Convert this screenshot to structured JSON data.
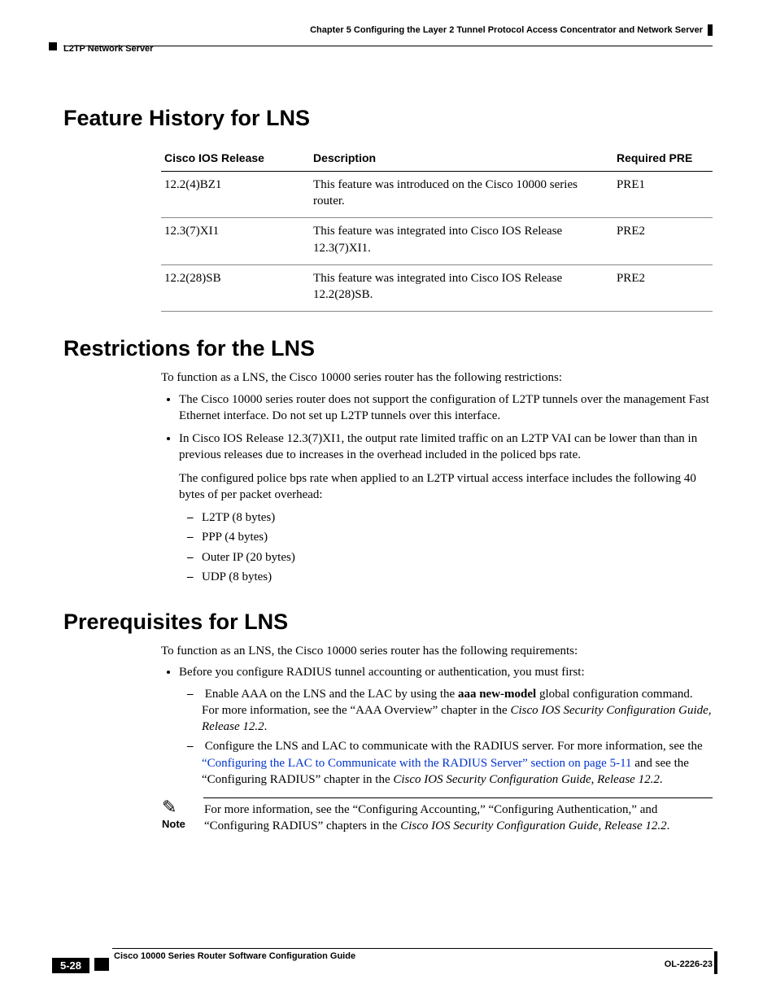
{
  "header": {
    "chapter": "Chapter 5      Configuring the Layer 2 Tunnel Protocol Access Concentrator and Network Server",
    "section": "L2TP Network Server"
  },
  "s1": {
    "heading": "Feature History for LNS",
    "th1": "Cisco IOS Release",
    "th2": "Description",
    "th3": "Required PRE",
    "rows": [
      {
        "r": "12.2(4)BZ1",
        "d": "This feature was introduced on the Cisco 10000 series router.",
        "p": "PRE1"
      },
      {
        "r": "12.3(7)XI1",
        "d": "This feature was integrated into Cisco IOS Release 12.3(7)XI1.",
        "p": "PRE2"
      },
      {
        "r": "12.2(28)SB",
        "d": "This feature was integrated into Cisco IOS Release 12.2(28)SB.",
        "p": "PRE2"
      }
    ]
  },
  "s2": {
    "heading": "Restrictions for the LNS",
    "intro": "To function as a LNS, the Cisco 10000 series router has the following restrictions:",
    "b1": "The Cisco 10000 series router does not support the configuration of L2TP tunnels over the management Fast Ethernet interface. Do not set up L2TP tunnels over this interface.",
    "b2": "In Cisco IOS Release 12.3(7)XI1, the output rate limited traffic on an L2TP VAI can be lower than than in previous releases due to increases in the overhead included in the policed bps rate.",
    "b2p": "The configured police bps rate when applied to an L2TP virtual access interface includes the following 40 bytes of per packet overhead:",
    "d1": "L2TP (8 bytes)",
    "d2": "PPP (4 bytes)",
    "d3": "Outer IP (20 bytes)",
    "d4": "UDP (8 bytes)"
  },
  "s3": {
    "heading": "Prerequisites for LNS",
    "intro": "To function as an LNS, the Cisco 10000 series router has the following requirements:",
    "b1": "Before you configure RADIUS tunnel accounting or authentication, you must first:",
    "d1a": "Enable AAA on the LNS and the LAC by using the ",
    "d1bold": "aaa new-model",
    "d1b": " global configuration command. For more information, see the “AAA Overview” chapter in the ",
    "d1it": "Cisco IOS Security Configuration Guide, Release 12.2",
    "d1c": ".",
    "d2a": "Configure the LNS and LAC to communicate with the RADIUS server. For more information, see the ",
    "d2link": "“Configuring the LAC to Communicate with the RADIUS Server” section on page 5-11",
    "d2b": " and see the “Configuring RADIUS” chapter in the ",
    "d2it": "Cisco IOS Security Configuration Guide, Release 12.2",
    "d2c": ".",
    "noteLabel": "Note",
    "noteTextA": "For more information, see the “Configuring Accounting,” “Configuring Authentication,” and “Configuring RADIUS” chapters in the ",
    "noteIt": "Cisco IOS Security Configuration Guide, Release 12.2",
    "noteTextB": "."
  },
  "footer": {
    "title": "Cisco 10000 Series Router Software Configuration Guide",
    "pagenum": "5-28",
    "ol": "OL-2226-23"
  }
}
